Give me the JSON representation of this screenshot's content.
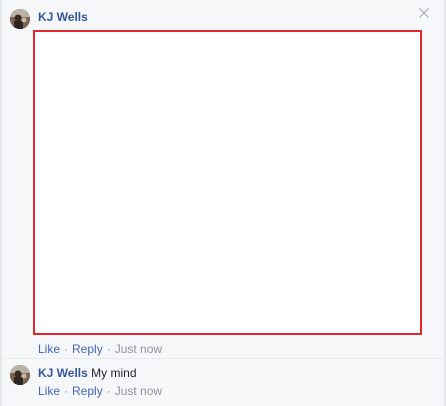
{
  "comments": [
    {
      "author": "KJ Wells",
      "text": "",
      "actions": {
        "like": "Like",
        "reply": "Reply",
        "time": "Just now"
      }
    },
    {
      "author": "KJ Wells",
      "text": "My mind",
      "actions": {
        "like": "Like",
        "reply": "Reply",
        "time": "Just now"
      }
    }
  ],
  "separator": "·",
  "colors": {
    "author": "#365899",
    "link": "#4267b2",
    "meta": "#90949c",
    "highlight_border": "#e0262e",
    "background": "#f6f7f9"
  },
  "icons": {
    "close": "close-icon",
    "avatar": "avatar"
  }
}
